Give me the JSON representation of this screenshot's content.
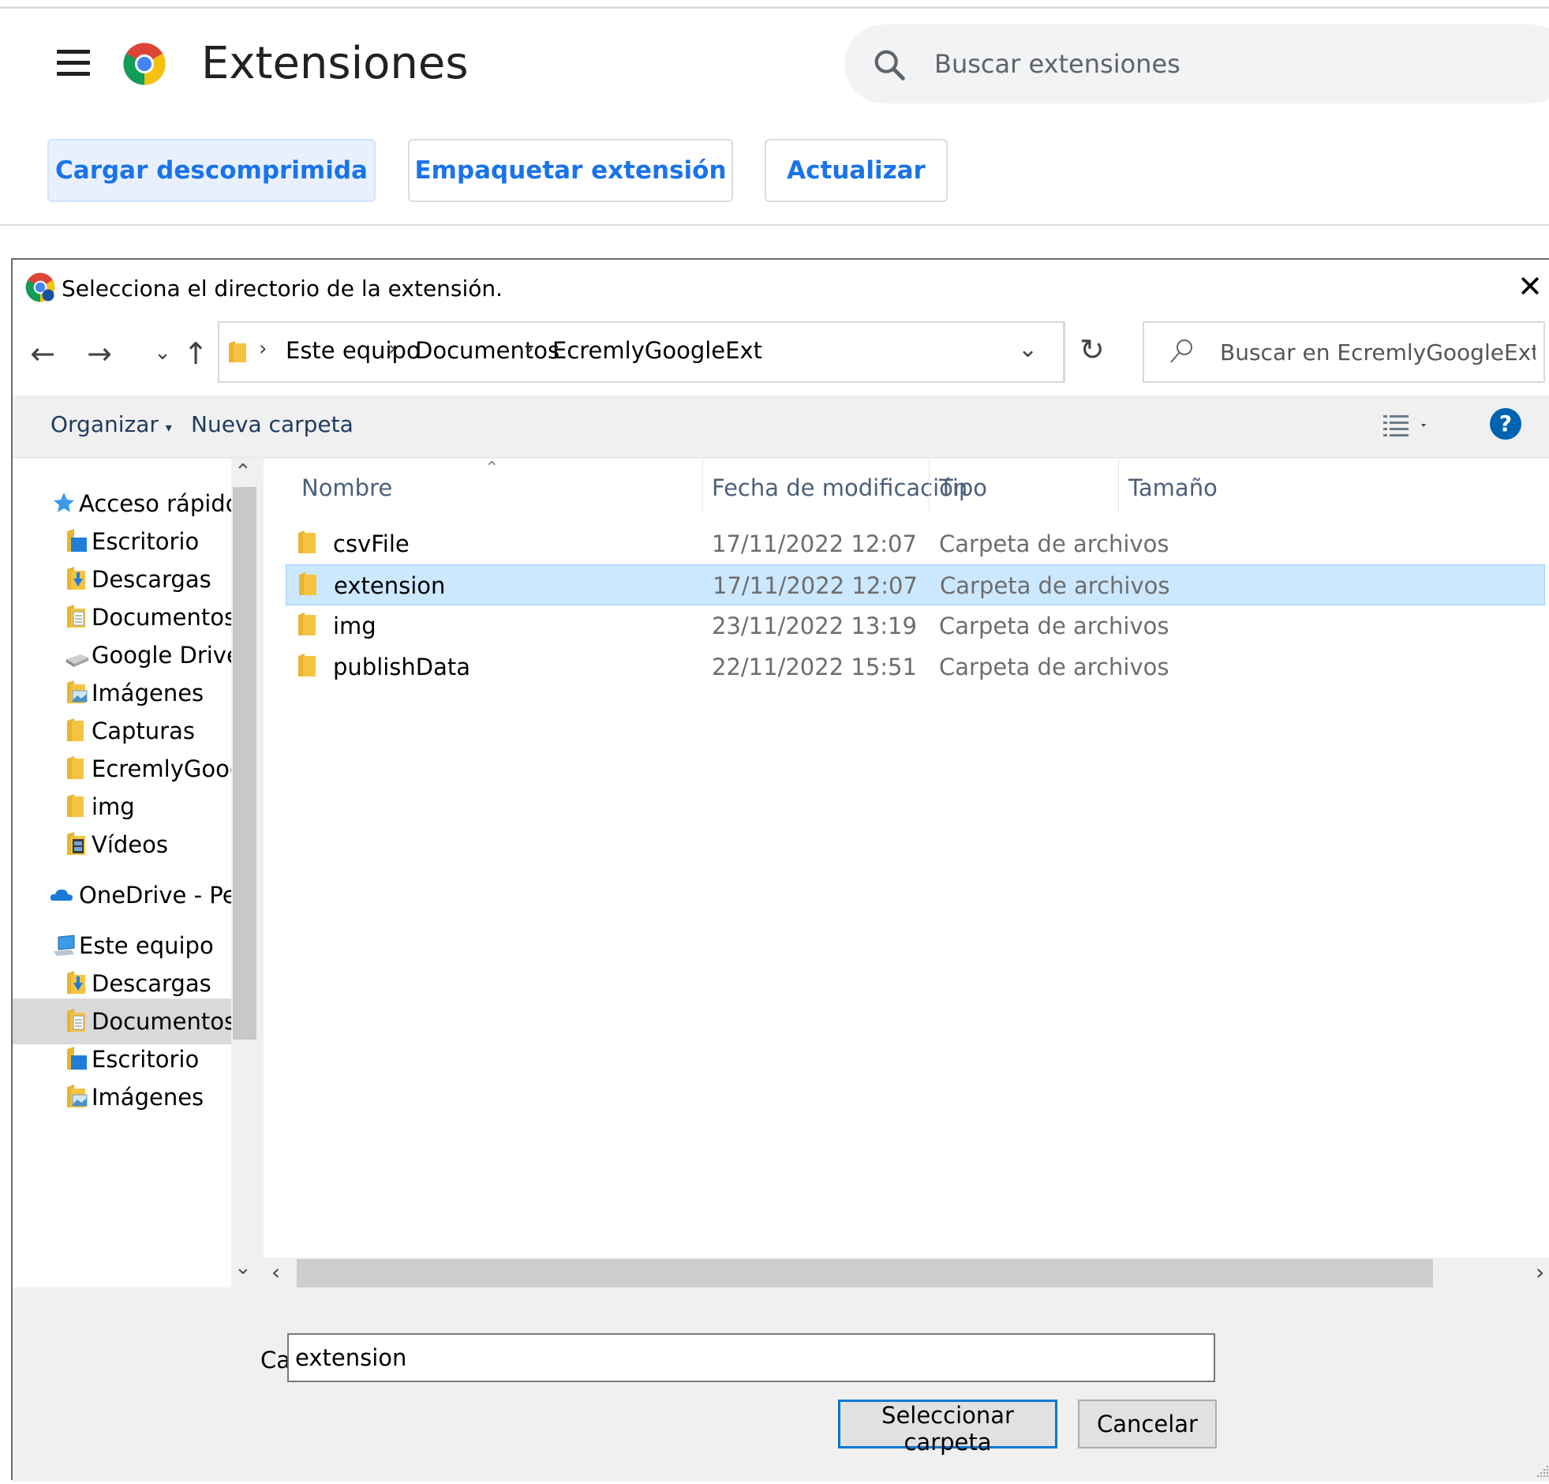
{
  "page": {
    "title": "Extensiones",
    "search_placeholder": "Buscar extensiones",
    "buttons": {
      "load_unpacked": "Cargar descomprimida",
      "pack": "Empaquetar extensión",
      "update": "Actualizar"
    }
  },
  "dialog": {
    "title": "Selecciona el directorio de la extensión.",
    "close": "✕",
    "breadcrumb": [
      "Este equipo",
      "Documentos",
      "EcremlyGoogleExt"
    ],
    "search_placeholder": "Buscar en EcremlyGoogleExt",
    "commands": {
      "organize": "Organizar",
      "organize_arrow": "▾",
      "new_folder": "Nueva carpeta",
      "help": "?"
    },
    "nav": {
      "quick_access": "Acceso rápido",
      "quick_items": [
        {
          "label": "Escritorio",
          "pinned": true
        },
        {
          "label": "Descargas",
          "pinned": true
        },
        {
          "label": "Documentos",
          "pinned": true
        },
        {
          "label": "Google Drive",
          "pinned": true
        },
        {
          "label": "Imágenes",
          "pinned": true
        },
        {
          "label": "Capturas",
          "pinned": false
        },
        {
          "label": "EcremlyGoogleExt",
          "pinned": false
        },
        {
          "label": "img",
          "pinned": false
        },
        {
          "label": "Vídeos",
          "pinned": false
        }
      ],
      "onedrive": "OneDrive - Personal",
      "this_pc": "Este equipo",
      "pc_items": [
        "Descargas",
        "Documentos",
        "Escritorio",
        "Imágenes"
      ],
      "selected": "Documentos"
    },
    "columns": [
      "Nombre",
      "Fecha de modificación",
      "Tipo",
      "Tamaño"
    ],
    "files": [
      {
        "name": "csvFile",
        "date": "17/11/2022 12:07",
        "type": "Carpeta de archivos"
      },
      {
        "name": "extension",
        "date": "17/11/2022 12:07",
        "type": "Carpeta de archivos"
      },
      {
        "name": "img",
        "date": "23/11/2022 13:19",
        "type": "Carpeta de archivos"
      },
      {
        "name": "publishData",
        "date": "22/11/2022 15:51",
        "type": "Carpeta de archivos"
      }
    ],
    "selected_file": "extension",
    "folder_label": "Carpeta:",
    "folder_value": "extension",
    "select_button": "Seleccionar carpeta",
    "cancel_button": "Cancelar"
  },
  "colors": {
    "accent": "#1a73e8",
    "selection": "#cce8ff",
    "folder": "#f5c342",
    "help": "#0063b1"
  }
}
